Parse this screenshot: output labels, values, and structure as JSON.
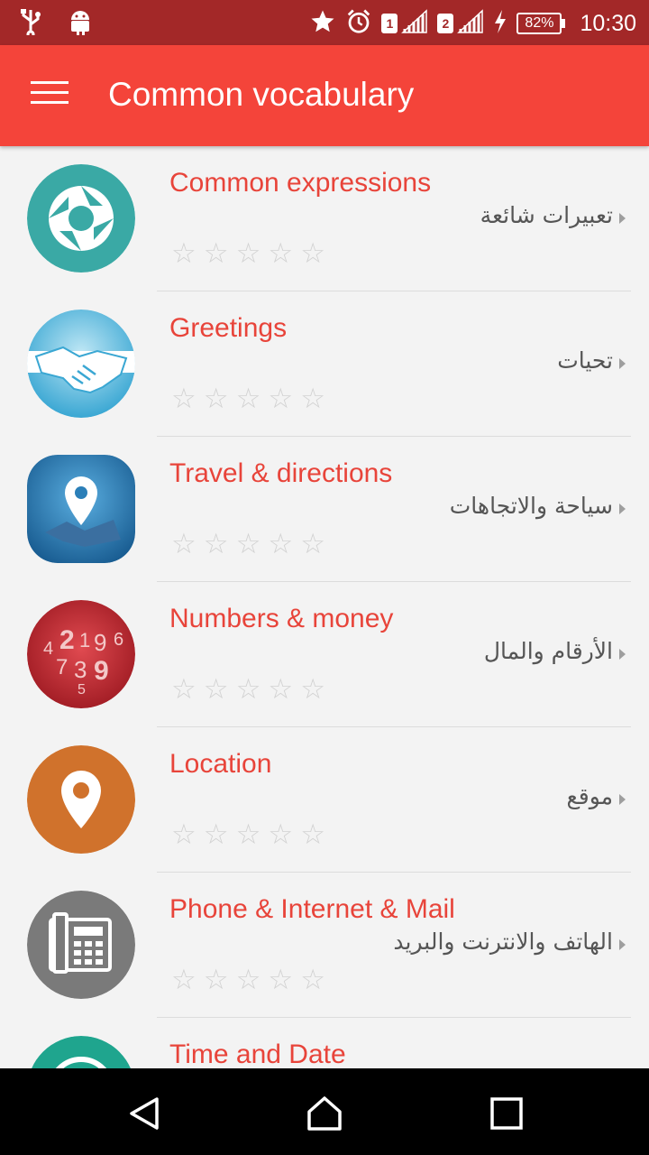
{
  "status_bar": {
    "time": "10:30",
    "battery": "82%",
    "sim1": "1",
    "sim2": "2",
    "icons": [
      "usb-icon",
      "android-icon",
      "star-icon",
      "alarm-icon",
      "signal-icon",
      "charging-icon"
    ]
  },
  "app_bar": {
    "title": "Common vocabulary",
    "menu_icon": "hamburger-menu-icon"
  },
  "categories": [
    {
      "title": "Common expressions",
      "arabic": "تعبيرات شائعة",
      "rating": 0,
      "icon": "expressions-icon",
      "color": "#3aa9a5"
    },
    {
      "title": "Greetings",
      "arabic": "تحيات",
      "rating": 0,
      "icon": "handshake-icon",
      "color": "#4fb6d8"
    },
    {
      "title": "Travel & directions",
      "arabic": "سياحة والاتجاهات",
      "rating": 0,
      "icon": "map-pin-icon",
      "color": "#2b7fb8"
    },
    {
      "title": "Numbers & money",
      "arabic": "الأرقام والمال",
      "rating": 0,
      "icon": "numbers-icon",
      "color": "#c4262e"
    },
    {
      "title": "Location",
      "arabic": "موقع",
      "rating": 0,
      "icon": "location-pin-icon",
      "color": "#d0722c"
    },
    {
      "title": "Phone & Internet & Mail",
      "arabic": "الهاتف والانترنت والبريد",
      "rating": 0,
      "icon": "phone-icon",
      "color": "#7a7a7a"
    },
    {
      "title": "Time and Date",
      "arabic": "",
      "rating": 0,
      "icon": "clock-icon",
      "color": "#1fa58e"
    }
  ],
  "nav_bar": {
    "back_icon": "back-triangle-icon",
    "home_icon": "home-icon",
    "recents_icon": "recents-square-icon"
  },
  "colors": {
    "status_bar": "#a32828",
    "app_bar": "#f4443a",
    "title_text": "#e8443a",
    "background": "#f3f3f3",
    "star_empty": "#d2d2d2"
  }
}
